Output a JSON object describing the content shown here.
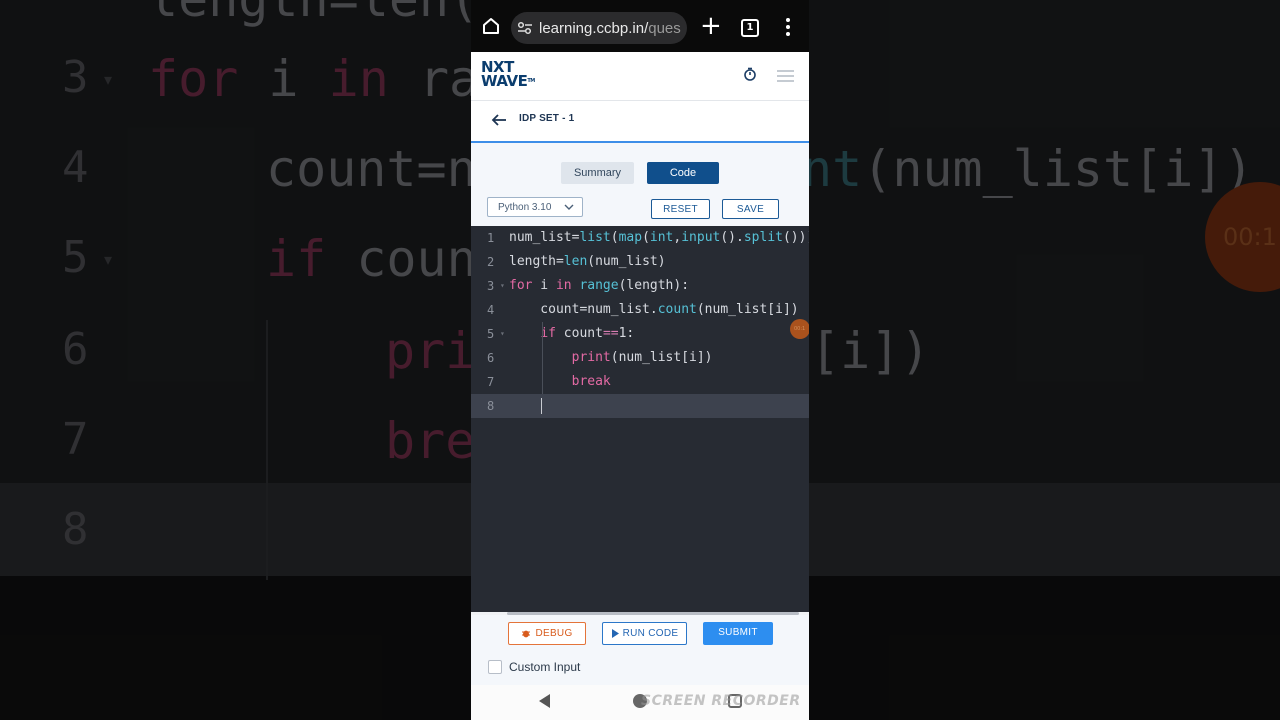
{
  "background": {
    "line_numbers": [
      "3",
      "4",
      "5",
      "6",
      "7",
      "8"
    ],
    "top_partial": "length=len(",
    "lines": {
      "l3": {
        "kw1": "for",
        "mid": " i ",
        "kw2": "in",
        "tail": " ra"
      },
      "l4": {
        "text": "count=n",
        "fn": "nt",
        "tail": "(num_list[i])"
      },
      "l5": {
        "kw": "if",
        "tail": " coun"
      },
      "l6": {
        "fn": "prin",
        "tail": "[i])"
      },
      "l7": {
        "kw": "bre"
      }
    },
    "timer_text": "00:1"
  },
  "browser": {
    "url_main": "learning.ccbp.in/",
    "url_fade": "ques",
    "tab_count": "1"
  },
  "app": {
    "logo_line1": "NXT",
    "logo_line2": "WAVE",
    "logo_tm": "TM",
    "set_title": "IDP SET - 1"
  },
  "toolbar": {
    "tabs": [
      "Summary",
      "Code"
    ],
    "active_tab": "Code",
    "language": "Python 3.10",
    "reset_label": "RESET",
    "save_label": "SAVE"
  },
  "editor": {
    "lines": [
      {
        "num": "1",
        "parts": [
          [
            "t",
            "num_list="
          ],
          [
            "f",
            "list"
          ],
          [
            "t",
            "("
          ],
          [
            "f",
            "map"
          ],
          [
            "t",
            "("
          ],
          [
            "f",
            "int"
          ],
          [
            "t",
            ","
          ],
          [
            "f",
            "input"
          ],
          [
            "t",
            "()."
          ],
          [
            "f",
            "split"
          ],
          [
            "t",
            "()))"
          ]
        ]
      },
      {
        "num": "2",
        "parts": [
          [
            "t",
            "length="
          ],
          [
            "f",
            "len"
          ],
          [
            "t",
            "(num_list)"
          ]
        ]
      },
      {
        "num": "3",
        "parts": [
          [
            "k",
            "for"
          ],
          [
            "t",
            " i "
          ],
          [
            "k",
            "in"
          ],
          [
            "t",
            " "
          ],
          [
            "f",
            "range"
          ],
          [
            "t",
            "(length):"
          ]
        ]
      },
      {
        "num": "4",
        "parts": [
          [
            "t",
            "    count=num_list."
          ],
          [
            "f",
            "count"
          ],
          [
            "t",
            "(num_list[i])"
          ]
        ]
      },
      {
        "num": "5",
        "parts": [
          [
            "t",
            "    "
          ],
          [
            "k",
            "if"
          ],
          [
            "t",
            " count"
          ],
          [
            "o",
            "=="
          ],
          [
            "t",
            "1:"
          ]
        ]
      },
      {
        "num": "6",
        "parts": [
          [
            "t",
            "        "
          ],
          [
            "k",
            "print"
          ],
          [
            "t",
            "(num_list[i])"
          ]
        ]
      },
      {
        "num": "7",
        "parts": [
          [
            "t",
            "        "
          ],
          [
            "k",
            "break"
          ]
        ]
      },
      {
        "num": "8",
        "parts": [
          [
            "t",
            ""
          ]
        ]
      }
    ],
    "active_line": 8,
    "fold_lines": [
      3,
      5
    ],
    "overlay_timer": "00:1"
  },
  "actions": {
    "debug_label": "DEBUG",
    "run_label": "RUN CODE",
    "submit_label": "SUBMIT",
    "custom_input_label": "Custom Input",
    "custom_input_checked": false
  },
  "system": {
    "watermark": "SCREEN RECORDER"
  },
  "colors": {
    "brand_blue": "#104f8c",
    "submit_blue": "#2d8ef0",
    "debug_orange": "#e4743a",
    "editor_bg": "#272b33",
    "keyword_pink": "#e36aa4",
    "function_cyan": "#56c1d6"
  }
}
